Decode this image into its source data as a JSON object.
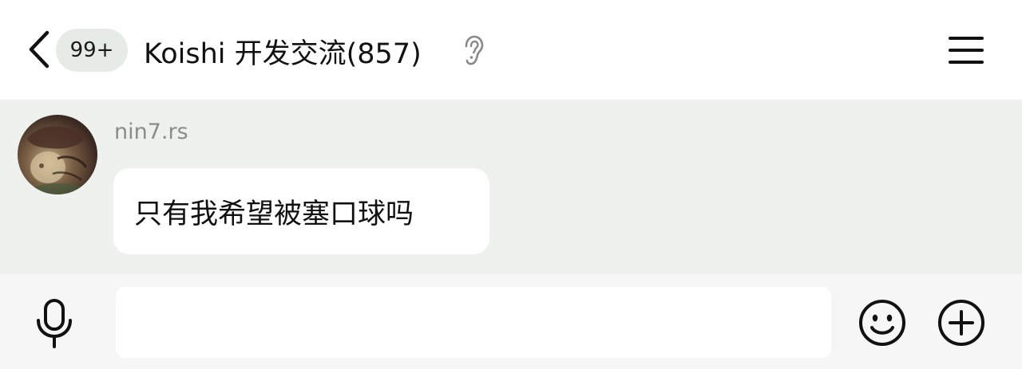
{
  "header": {
    "back_icon": "chevron-left-icon",
    "unread_badge": "99+",
    "title": "Koishi 开发交流(857)",
    "ear_icon": "ear-icon",
    "menu_icon": "hamburger-menu-icon"
  },
  "messages": [
    {
      "sender": "nin7.rs",
      "text": "只有我希望被塞口球吗"
    }
  ],
  "input_bar": {
    "mic_icon": "microphone-icon",
    "input_value": "",
    "input_placeholder": "",
    "emoji_icon": "smiley-icon",
    "plus_icon": "plus-circle-icon"
  },
  "colors": {
    "header_bg": "#ffffff",
    "message_area_bg": "#eef1ee",
    "bubble_bg": "#ffffff",
    "badge_bg": "#e6ebe7",
    "input_bar_bg": "#f5f6f5",
    "sender_name": "#8a8d8b",
    "text": "#111111"
  }
}
